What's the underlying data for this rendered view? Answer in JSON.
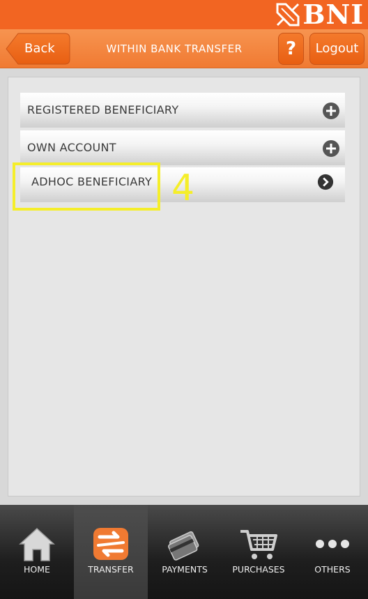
{
  "brand": {
    "name": "BNI",
    "color": "#f26522"
  },
  "header": {
    "back_label": "Back",
    "title": "WITHIN BANK TRANSFER",
    "help_label": "?",
    "logout_label": "Logout"
  },
  "menu": {
    "items": [
      {
        "label": "REGISTERED BENEFICIARY",
        "icon": "plus-circle-icon"
      },
      {
        "label": "OWN ACCOUNT",
        "icon": "plus-circle-icon"
      },
      {
        "label": "ADHOC BENEFICIARY",
        "icon": "chevron-right-circle-icon"
      }
    ]
  },
  "annotation": {
    "step": "4",
    "color": "#f5ee2a"
  },
  "tabbar": {
    "items": [
      {
        "label": "HOME",
        "icon": "home-icon"
      },
      {
        "label": "TRANSFER",
        "icon": "transfer-icon",
        "active": true
      },
      {
        "label": "PAYMENTS",
        "icon": "payments-icon"
      },
      {
        "label": "PURCHASES",
        "icon": "cart-icon"
      },
      {
        "label": "OTHERS",
        "icon": "more-icon"
      }
    ]
  }
}
